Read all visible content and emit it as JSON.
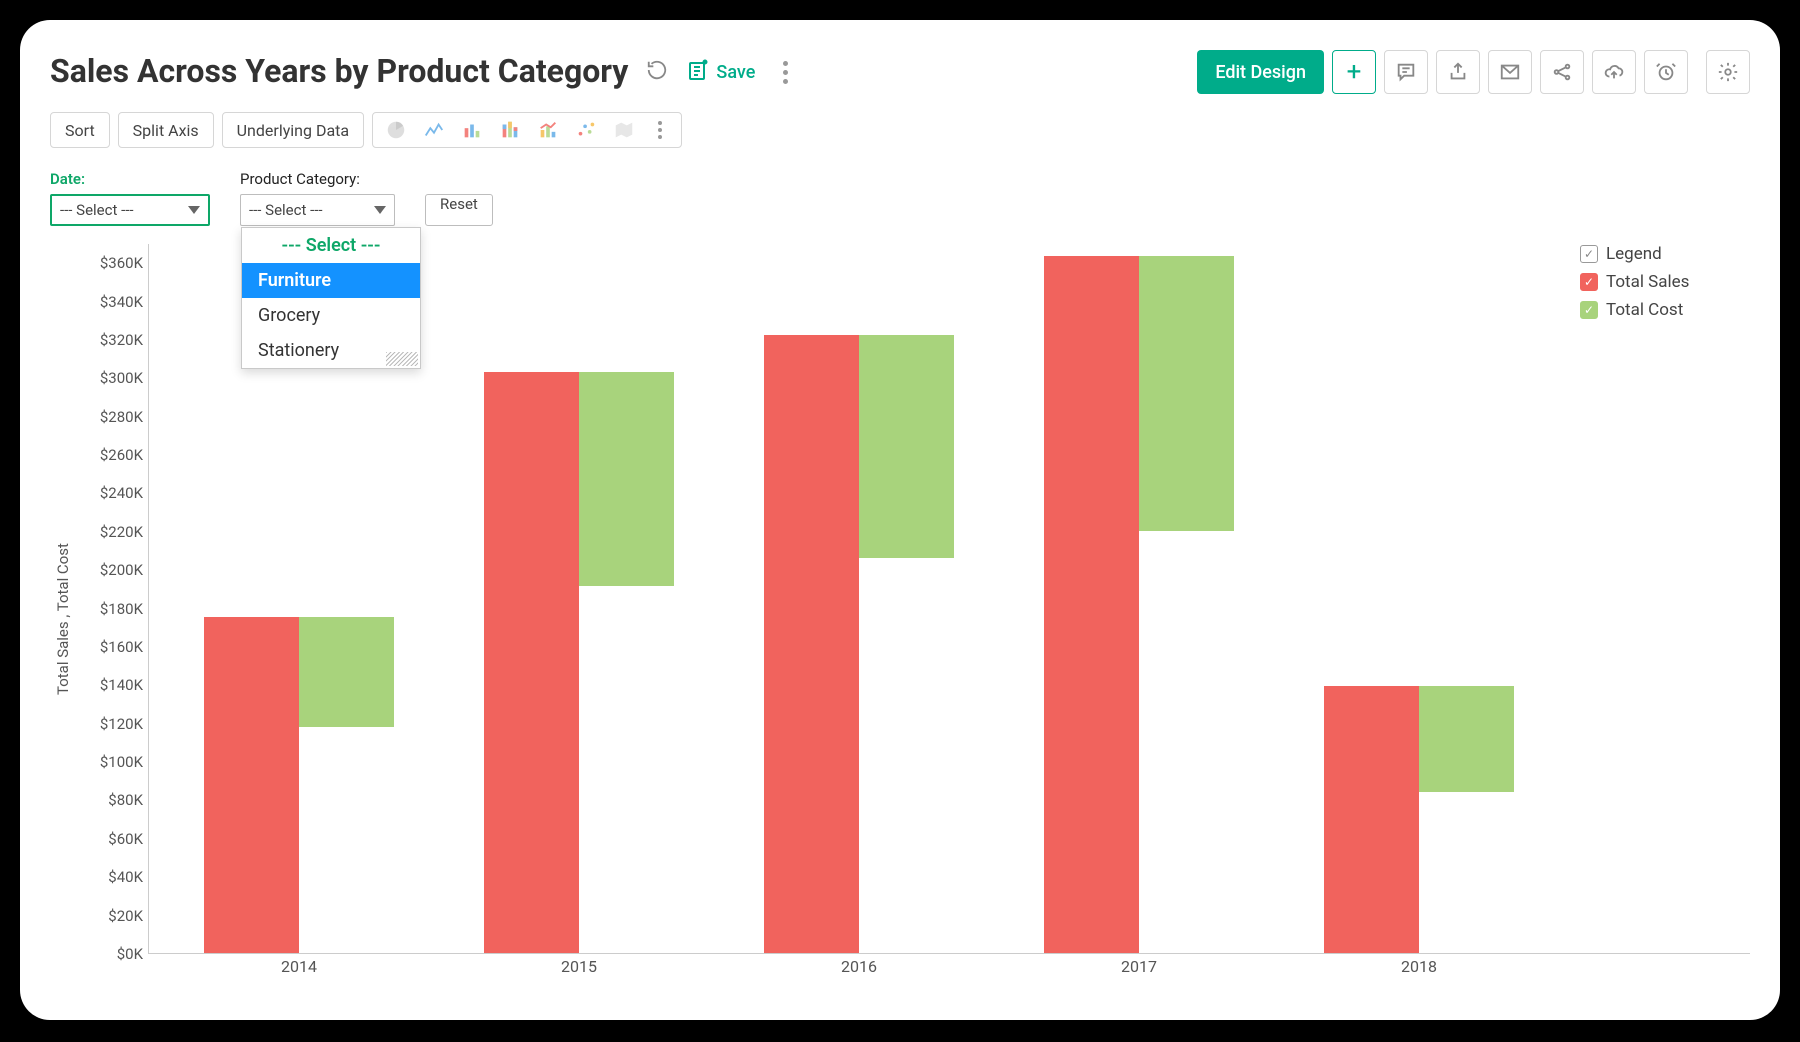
{
  "header": {
    "title": "Sales Across Years by Product Category",
    "save_label": "Save",
    "edit_design_label": "Edit Design"
  },
  "toolbar": {
    "sort_label": "Sort",
    "split_axis_label": "Split Axis",
    "underlying_data_label": "Underlying Data"
  },
  "filters": {
    "date_label": "Date:",
    "date_value": "--- Select ---",
    "category_label": "Product Category:",
    "category_value": "--- Select ---",
    "reset_label": "Reset",
    "dropdown_options": {
      "placeholder": "--- Select ---",
      "highlighted": "Furniture",
      "opt2": "Grocery",
      "opt3": "Stationery"
    }
  },
  "legend": {
    "title": "Legend",
    "series1": "Total Sales",
    "series2": "Total Cost"
  },
  "axis": {
    "y_title": "Total Sales , Total Cost",
    "ticks": [
      "$360K",
      "$340K",
      "$320K",
      "$300K",
      "$280K",
      "$260K",
      "$240K",
      "$220K",
      "$200K",
      "$180K",
      "$160K",
      "$140K",
      "$120K",
      "$100K",
      "$80K",
      "$60K",
      "$40K",
      "$20K",
      "$0K"
    ],
    "x_labels": [
      "2014",
      "2015",
      "2016",
      "2017",
      "2018"
    ]
  },
  "chart_data": {
    "type": "bar",
    "title": "Sales Across Years by Product Category",
    "xlabel": "",
    "ylabel": "Total Sales , Total Cost",
    "ylim": [
      0,
      370
    ],
    "y_unit": "$K",
    "categories": [
      "2014",
      "2015",
      "2016",
      "2017",
      "2018"
    ],
    "series": [
      {
        "name": "Total Sales",
        "color": "#f1635d",
        "values": [
          175,
          303,
          322,
          363,
          139
        ]
      },
      {
        "name": "Total Cost",
        "color": "#a8d37c",
        "values": [
          57,
          112,
          116,
          143,
          55
        ]
      }
    ],
    "legend_position": "right",
    "grid": true
  }
}
